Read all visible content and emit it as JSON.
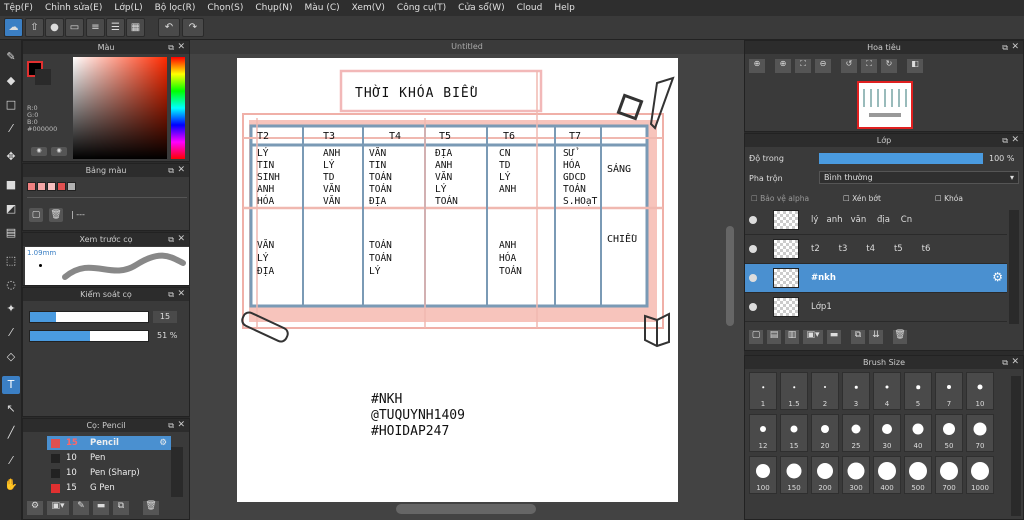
{
  "menu": [
    "Tệp(F)",
    "Chỉnh sửa(E)",
    "Lớp(L)",
    "Bộ lọc(R)",
    "Chọn(S)",
    "Chụp(N)",
    "Màu (C)",
    "Xem(V)",
    "Công cụ(T)",
    "Cửa sổ(W)",
    "Cloud",
    "Help"
  ],
  "document_tab": "Untitled",
  "color_panel": {
    "title": "Màu",
    "r": "R:0",
    "g": "G:0",
    "b": "B:0",
    "hex": "#000000"
  },
  "palette_panel": {
    "title": "Bảng màu",
    "name": "---",
    "swatches": [
      "#f08080",
      "#f4a6a6",
      "#f7c0c0",
      "#e05050",
      "#b0b0b0"
    ]
  },
  "preview_panel": {
    "title": "Xem trước cọ",
    "size": "1.09mm"
  },
  "brush_control": {
    "title": "Kiểm soát cọ",
    "size": "15",
    "opacity": "51 %",
    "size_fill": 0.22,
    "opacity_fill": 0.51
  },
  "brush_panel": {
    "title": "Cọ: Pencil",
    "items": [
      {
        "size": "15",
        "name": "Pencil",
        "color": "#e05050",
        "active": true
      },
      {
        "size": "10",
        "name": "Pen",
        "color": "#222222",
        "active": false
      },
      {
        "size": "10",
        "name": "Pen (Sharp)",
        "color": "#222222",
        "active": false
      },
      {
        "size": "15",
        "name": "G Pen",
        "color": "#e03030",
        "active": false
      }
    ]
  },
  "navigator": {
    "title": "Hoa tiêu"
  },
  "layers": {
    "title": "Lớp",
    "opacity_label": "Độ trong",
    "opacity_value": "100 %",
    "opacity_fill": 1.0,
    "blend_label": "Pha trộn",
    "blend_value": "Bình thường",
    "alpha_label": "Bảo vệ alpha",
    "clip_label": "Xén bớt",
    "lock_label": "Khóa",
    "rows": [
      {
        "name": "lý   anh   văn    địa    Cn",
        "selected": false
      },
      {
        "name": "t2       t3       t4       t5       t6",
        "selected": false
      },
      {
        "name": "#nkh",
        "selected": true
      },
      {
        "name": "Lớp1",
        "selected": false
      }
    ]
  },
  "brush_size": {
    "title": "Brush Size",
    "sizes": [
      "1",
      "1.5",
      "2",
      "3",
      "4",
      "5",
      "7",
      "10",
      "12",
      "15",
      "20",
      "25",
      "30",
      "40",
      "50",
      "70",
      "100",
      "150",
      "200",
      "300",
      "400",
      "500",
      "700",
      "1000"
    ]
  },
  "drawing": {
    "title": "THỜI KHÓA BIỂU",
    "days": [
      "T2",
      "T3",
      "T4",
      "T5",
      "T6",
      "T7"
    ],
    "morning": [
      [
        "LÝ",
        "TIN",
        "SINH",
        "ANH",
        "HÓA"
      ],
      [
        "ANH",
        "LÝ",
        "TD",
        "VĂN",
        "VĂN"
      ],
      [
        "VĂN",
        "TIN",
        "TOÁN",
        "TOÁN",
        "ĐỊA"
      ],
      [
        "ĐỊA",
        "ANH",
        "VĂN",
        "LÝ",
        "TOÁN"
      ],
      [
        "CN",
        "TD",
        "LÝ",
        "ANH"
      ],
      [
        "SỬ",
        "HÓA",
        "GDCD",
        "TOÁN",
        "S.HOạT"
      ]
    ],
    "afternoon": [
      [
        "VĂN",
        "LÝ",
        "ĐỊA"
      ],
      [],
      [
        "TOÁN",
        "TOÁN",
        "LÝ"
      ],
      [],
      [
        "ANH",
        "HÓA",
        "TOÁN"
      ],
      []
    ],
    "sang": "SÁNG",
    "chieu": "CHIỀU",
    "credits": [
      "#NKH",
      "@TUQUYNH1409",
      "#HOIDAP247"
    ]
  }
}
